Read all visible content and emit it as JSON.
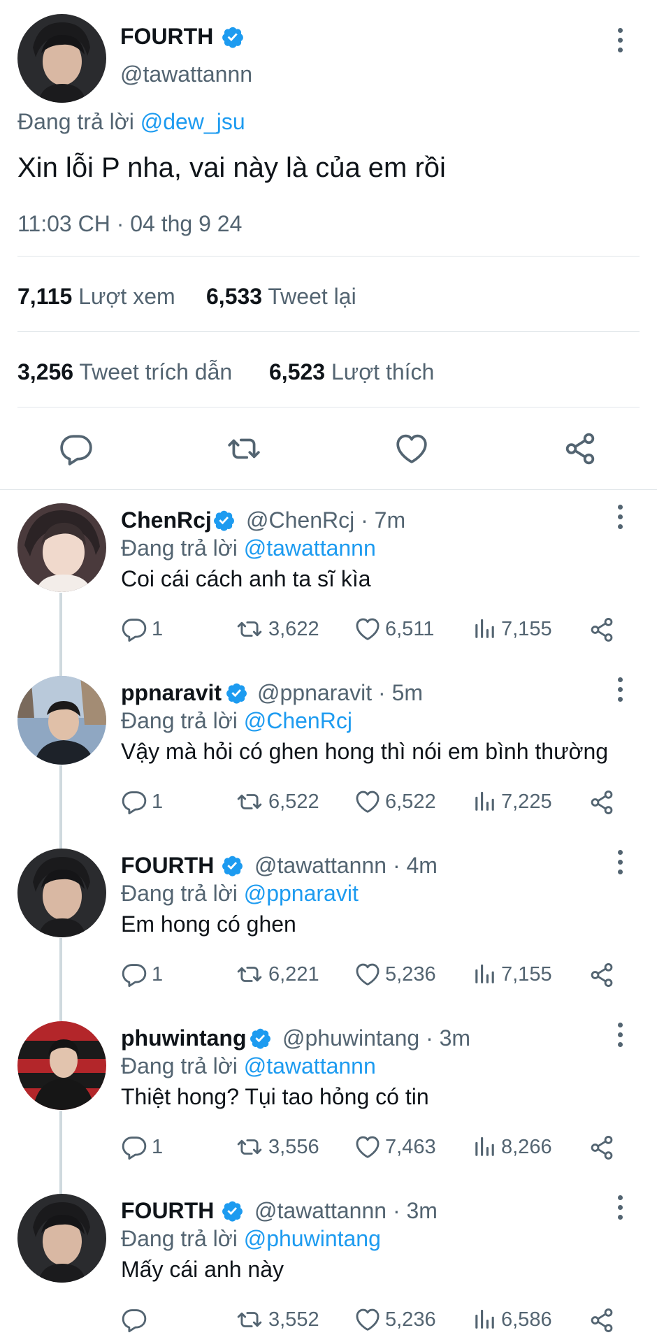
{
  "main_tweet": {
    "name": "FOURTH",
    "handle": "@tawattannn",
    "replying_prefix": "Đang trả lời",
    "replying_to": "@dew_jsu",
    "text": "Xin lỗi P nha, vai này là của em rồi",
    "timestamp": "11:03 CH · 04 thg 9 24",
    "views_count": "7,115",
    "views_label": "Lượt xem",
    "retweets_count": "6,533",
    "retweets_label": "Tweet lại",
    "quotes_count": "3,256",
    "quotes_label": "Tweet trích dẫn",
    "likes_count": "6,523",
    "likes_label": "Lượt thích"
  },
  "replies": [
    {
      "name": "ChenRcj",
      "handle": "@ChenRcj · 7m",
      "replying_prefix": "Đang trả lời",
      "replying_to": "@tawattannn",
      "text": "Coi cái cách anh ta sĩ kìa",
      "replies": "1",
      "retweets": "3,622",
      "likes": "6,511",
      "views": "7,155"
    },
    {
      "name": "ppnaravit",
      "handle": "@ppnaravit · 5m",
      "replying_prefix": "Đang trả lời",
      "replying_to": "@ChenRcj",
      "text": "Vậy mà hỏi có ghen hong thì nói em bình thường",
      "replies": "1",
      "retweets": "6,522",
      "likes": "6,522",
      "views": "7,225"
    },
    {
      "name": "FOURTH",
      "handle": "@tawattannn · 4m",
      "replying_prefix": "Đang trả lời",
      "replying_to": "@ppnaravit",
      "text": "Em hong có ghen",
      "replies": "1",
      "retweets": "6,221",
      "likes": "5,236",
      "views": "7,155"
    },
    {
      "name": "phuwintang",
      "handle": "@phuwintang · 3m",
      "replying_prefix": "Đang trả lời",
      "replying_to": "@tawattannn",
      "text": "Thiệt hong? Tụi tao hỏng có tin",
      "replies": "1",
      "retweets": "3,556",
      "likes": "7,463",
      "views": "8,266"
    },
    {
      "name": "FOURTH",
      "handle": "@tawattannn · 3m",
      "replying_prefix": "Đang trả lời",
      "replying_to": "@phuwintang",
      "text": "Mấy cái anh này",
      "replies": "",
      "retweets": "3,552",
      "likes": "5,236",
      "views": "6,586"
    }
  ],
  "colors": {
    "verified": "#1d9bf0",
    "link": "#1d9bf0",
    "muted": "#536471",
    "text": "#0f1419"
  },
  "icons": [
    "verified-badge-icon",
    "more-options-icon",
    "reply-icon",
    "retweet-icon",
    "like-icon",
    "share-icon",
    "views-icon"
  ]
}
